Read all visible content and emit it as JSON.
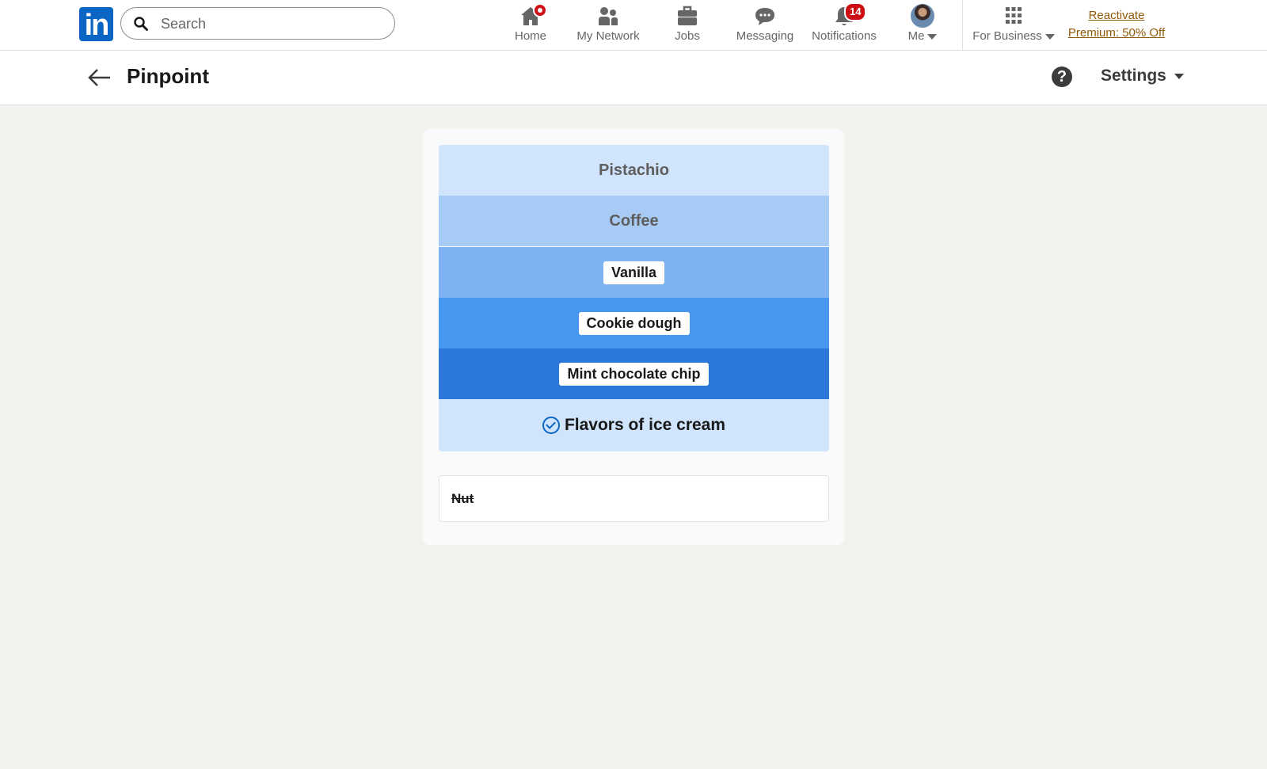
{
  "nav": {
    "search_placeholder": "Search",
    "items": [
      {
        "label": "Home",
        "icon": "home-icon"
      },
      {
        "label": "My Network",
        "icon": "network-icon"
      },
      {
        "label": "Jobs",
        "icon": "briefcase-icon"
      },
      {
        "label": "Messaging",
        "icon": "chat-icon"
      },
      {
        "label": "Notifications",
        "icon": "bell-icon",
        "badge": "14"
      },
      {
        "label": "Me",
        "icon": "avatar"
      }
    ],
    "business": "For Business",
    "premium_line1": "Reactivate",
    "premium_line2": "Premium: 50% Off"
  },
  "page": {
    "title": "Pinpoint",
    "help": "?",
    "settings": "Settings"
  },
  "game": {
    "clues": [
      {
        "text": "Pistachio",
        "color": "#d0e4fb",
        "style": "ghost"
      },
      {
        "text": "Coffee",
        "color": "#a8cbf6",
        "style": "ghost"
      },
      {
        "text": "Vanilla",
        "color": "#7fb2f3",
        "style": "pill"
      },
      {
        "text": "Cookie dough",
        "color": "#4796ef",
        "style": "pill"
      },
      {
        "text": "Mint chocolate chip",
        "color": "#2b78d9",
        "style": "pill"
      }
    ],
    "answer": "Flavors of ice cream",
    "answer_color": "#d0e4fb",
    "wrong_guess": "Nut"
  },
  "colors": {
    "linkedin_blue": "#0a66c2",
    "badge_red": "#cc1016",
    "premium_gold": "#915907",
    "page_bg": "#f3f2ef"
  }
}
